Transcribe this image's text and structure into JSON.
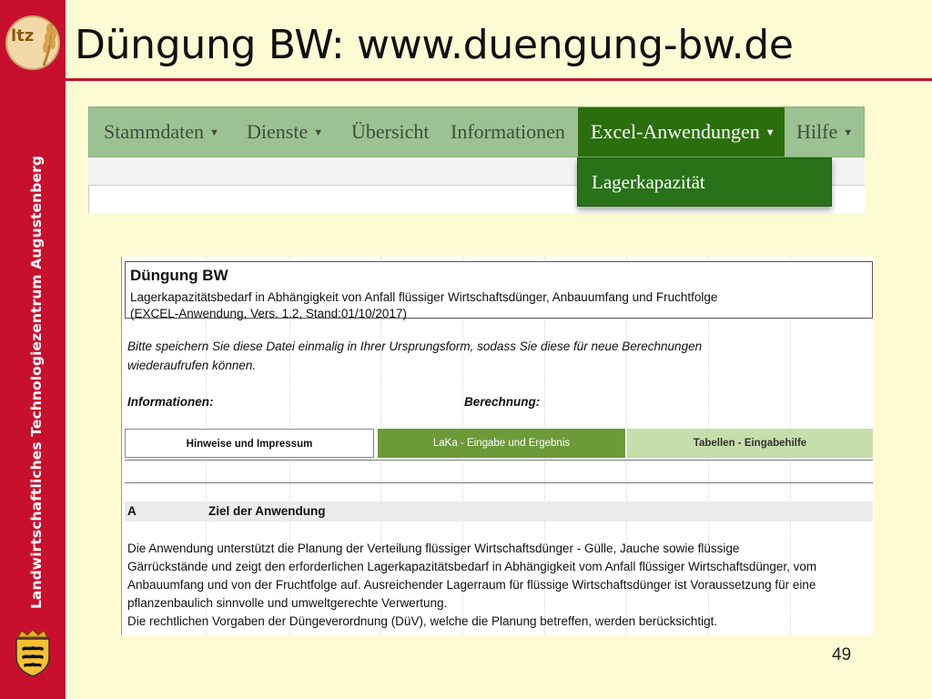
{
  "slide": {
    "title": "Düngung BW: www.duengung-bw.de",
    "side_text": "Landwirtschaftliches Technologiezentrum Augustenberg",
    "logo_text": "ltz",
    "page_number": "49",
    "colors": {
      "band": "#c8102e",
      "background": "#fdfbd4"
    }
  },
  "website": {
    "nav": [
      {
        "label": "Stammdaten",
        "caret": true,
        "active": false
      },
      {
        "label": "Dienste",
        "caret": true,
        "active": false
      },
      {
        "label": "Übersicht",
        "caret": false,
        "active": false
      },
      {
        "label": "Informationen",
        "caret": false,
        "active": false
      },
      {
        "label": "Excel-Anwendungen",
        "caret": true,
        "active": true
      },
      {
        "label": "Hilfe",
        "caret": true,
        "active": false
      }
    ],
    "dropdown": {
      "item": "Lagerkapazität"
    },
    "colors": {
      "navbar": "#9cc192",
      "active": "#2b6e0d"
    }
  },
  "sheet": {
    "heading": "Düngung BW",
    "subtitle1": "Lagerkapazitätsbedarf in Abhängigkeit von Anfall flüssiger Wirtschaftsdünger, Anbauumfang und Fruchtfolge",
    "subtitle2": "(EXCEL-Anwendung, Vers. 1.2, Stand:01/10/2017)",
    "note_line1": "Bitte speichern Sie diese Datei einmalig in Ihrer Ursprungsform, sodass Sie diese für neue Berechnungen",
    "note_line2": "wiederaufrufen können.",
    "label_info": "Informationen:",
    "label_calc": "Berechnung:",
    "buttons": {
      "hinweise": "Hinweise und Impressum",
      "laka": "LaKa - Eingabe und Ergebnis",
      "tabellen": "Tabellen - Eingabehilfe"
    },
    "section": {
      "letter": "A",
      "title": "Ziel der Anwendung"
    },
    "paragraph": [
      "Die Anwendung unterstützt die Planung der Verteilung flüssiger Wirtschaftsdünger - Gülle, Jauche sowie flüssige",
      "Gärrückstände und zeigt den erforderlichen Lagerkapazitätsbedarf in Abhängigkeit vom Anfall flüssiger Wirtschaftsdünger, vom",
      "Anbauumfang und von der Fruchtfolge auf. Ausreichender Lagerraum für flüssige Wirtschaftsdünger ist Voraussetzung für eine",
      "pflanzenbaulich sinnvolle und umweltgerechte Verwertung.",
      "Die rechtlichen Vorgaben der Düngeverordnung (DüV), welche die Planung betreffen, werden berücksichtigt."
    ]
  }
}
